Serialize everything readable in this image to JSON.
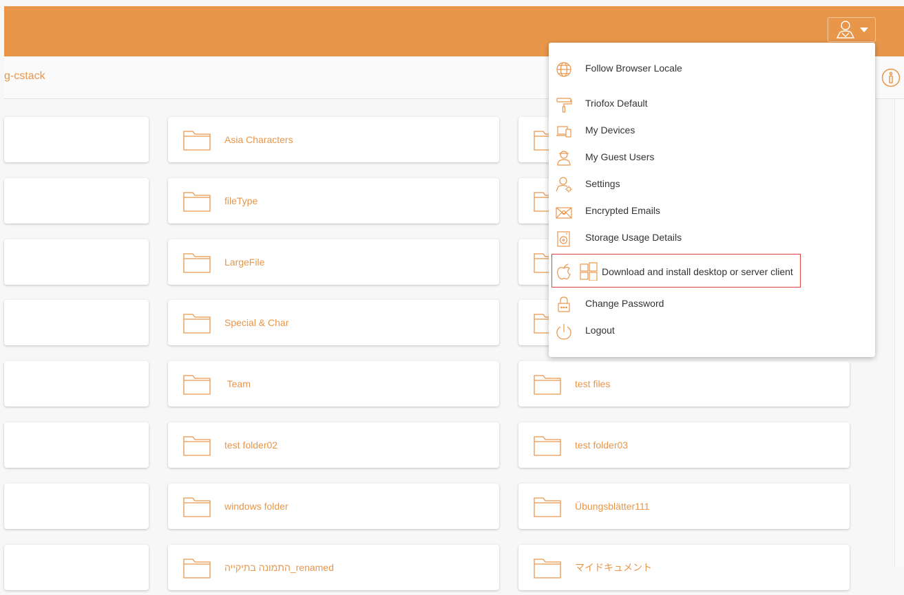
{
  "colors": {
    "accent": "#e8964a",
    "highlight_border": "#e2403a"
  },
  "header": {
    "user_icon": "user-icon",
    "caret_icon": "caret-down-icon"
  },
  "breadcrumb": {
    "text": "g-cstack"
  },
  "info_icon": "info-icon",
  "folders": {
    "col2": [
      "Asia Characters",
      "fileType",
      "LargeFile",
      "Special & Char",
      " Team",
      "test folder02",
      "windows folder",
      "התמונה בתיקייה_renamed"
    ],
    "col3": [
      "test files",
      "test folder03",
      "Übungsblätter111",
      "マイドキュメント"
    ]
  },
  "menu": {
    "items": [
      {
        "label": "Follow Browser Locale",
        "icon": "globe-icon"
      },
      {
        "label": "Triofox Default",
        "icon": "paint-roller-icon"
      },
      {
        "label": "My Devices",
        "icon": "devices-icon"
      },
      {
        "label": "My Guest Users",
        "icon": "guest-user-icon"
      },
      {
        "label": "Settings",
        "icon": "user-settings-icon"
      },
      {
        "label": "Encrypted Emails",
        "icon": "encrypted-email-icon"
      },
      {
        "label": "Storage Usage Details",
        "icon": "storage-disk-icon"
      },
      {
        "label": "Download and install desktop or server client",
        "icon": "apple-windows-icon",
        "highlighted": true
      },
      {
        "label": "Change Password",
        "icon": "lock-icon"
      },
      {
        "label": "Logout",
        "icon": "power-icon"
      }
    ]
  }
}
